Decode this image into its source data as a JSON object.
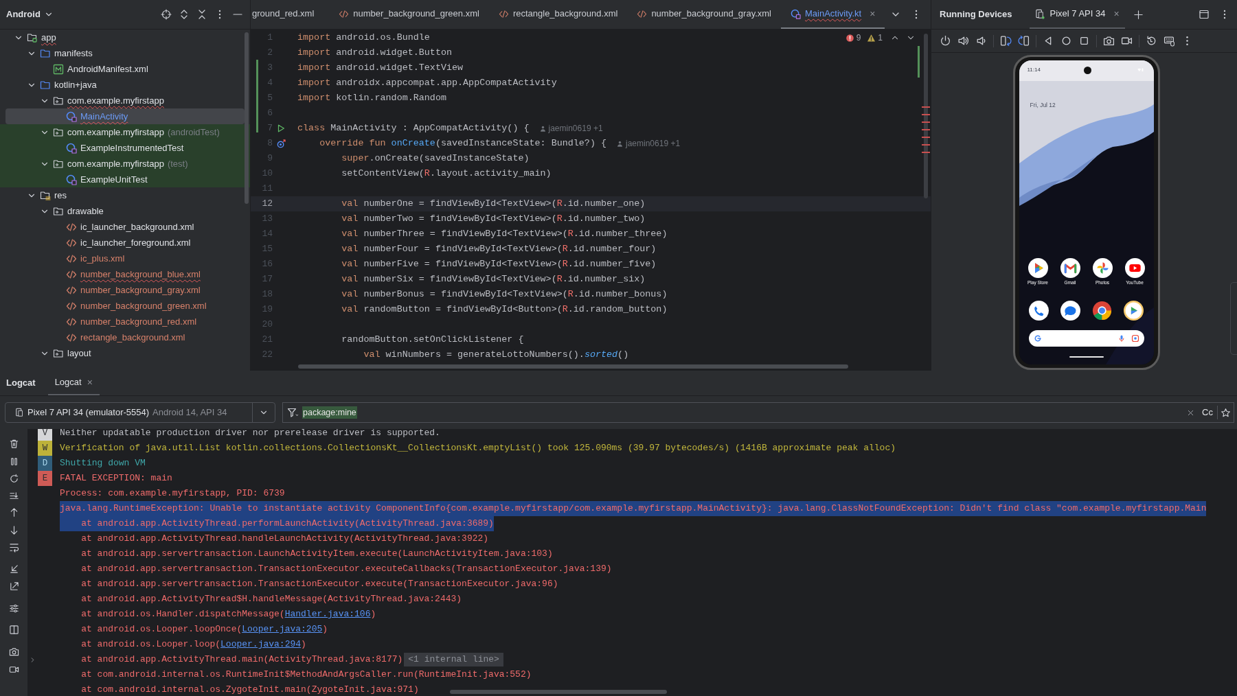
{
  "project_panel": {
    "title": "Android",
    "tree": [
      {
        "label": "app",
        "kind": "module",
        "expanded": true,
        "selected": false,
        "error": true,
        "color": "#dfe1e5",
        "children": [
          {
            "label": "manifests",
            "kind": "folder",
            "expanded": true,
            "selected": false,
            "error": false,
            "color": "#dfe1e5",
            "children": [
              {
                "label": "AndroidManifest.xml",
                "kind": "manifest",
                "selected": false,
                "error": false,
                "color": "#dfe1e5"
              }
            ]
          },
          {
            "label": "kotlin+java",
            "kind": "folder",
            "expanded": true,
            "selected": false,
            "error": false,
            "color": "#dfe1e5",
            "children": [
              {
                "label": "com.example.myfirstapp",
                "kind": "package",
                "expanded": true,
                "selected": false,
                "error": true,
                "test_source": false,
                "color": "#dfe1e5",
                "children": [
                  {
                    "label": "MainActivity",
                    "kind": "class",
                    "selected": true,
                    "error": true,
                    "color": "#6c9bf6"
                  }
                ]
              },
              {
                "label": "com.example.myfirstapp",
                "suffix": "(androidTest)",
                "kind": "package",
                "expanded": true,
                "selected": false,
                "error": false,
                "test_source": true,
                "color": "#dfe1e5",
                "children": [
                  {
                    "label": "ExampleInstrumentedTest",
                    "kind": "class",
                    "selected": false,
                    "error": false,
                    "color": "#dfe1e5"
                  }
                ]
              },
              {
                "label": "com.example.myfirstapp",
                "suffix": "(test)",
                "kind": "package",
                "expanded": true,
                "selected": false,
                "error": false,
                "test_source": true,
                "color": "#dfe1e5",
                "children": [
                  {
                    "label": "ExampleUnitTest",
                    "kind": "class",
                    "selected": false,
                    "error": false,
                    "color": "#dfe1e5"
                  }
                ]
              }
            ]
          },
          {
            "label": "res",
            "kind": "res",
            "expanded": true,
            "selected": false,
            "error": false,
            "color": "#dfe1e5",
            "children": [
              {
                "label": "drawable",
                "kind": "package",
                "expanded": true,
                "selected": false,
                "error": false,
                "color": "#dfe1e5",
                "children": [
                  {
                    "label": "ic_launcher_background.xml",
                    "kind": "xml",
                    "selected": false,
                    "error": false,
                    "color": "#dfe1e5"
                  },
                  {
                    "label": "ic_launcher_foreground.xml",
                    "kind": "xml",
                    "selected": false,
                    "error": false,
                    "color": "#dfe1e5"
                  },
                  {
                    "label": "ic_plus.xml",
                    "kind": "xml",
                    "selected": false,
                    "error": false,
                    "color": "#d9826b"
                  },
                  {
                    "label": "number_background_blue.xml",
                    "kind": "xml",
                    "selected": false,
                    "error": true,
                    "color": "#d9826b"
                  },
                  {
                    "label": "number_background_gray.xml",
                    "kind": "xml",
                    "selected": false,
                    "error": false,
                    "color": "#d9826b"
                  },
                  {
                    "label": "number_background_green.xml",
                    "kind": "xml",
                    "selected": false,
                    "error": false,
                    "color": "#d9826b"
                  },
                  {
                    "label": "number_background_red.xml",
                    "kind": "xml",
                    "selected": false,
                    "error": false,
                    "color": "#d9826b"
                  },
                  {
                    "label": "rectangle_background.xml",
                    "kind": "xml",
                    "selected": false,
                    "error": false,
                    "color": "#d9826b"
                  }
                ]
              },
              {
                "label": "layout",
                "kind": "package",
                "expanded": true,
                "selected": false,
                "error": false,
                "color": "#dfe1e5"
              }
            ]
          }
        ]
      }
    ]
  },
  "editor": {
    "tabs": [
      {
        "label": "ground_red.xml",
        "kind": "cut",
        "selected": false,
        "error": false
      },
      {
        "label": "number_background_green.xml",
        "kind": "xml",
        "selected": false,
        "error": false
      },
      {
        "label": "rectangle_background.xml",
        "kind": "xml",
        "selected": false,
        "error": false
      },
      {
        "label": "number_background_gray.xml",
        "kind": "xml",
        "selected": false,
        "error": false
      },
      {
        "label": "MainActivity.kt",
        "kind": "class",
        "selected": true,
        "error": true,
        "close": "×"
      }
    ],
    "errors": "9",
    "warnings": "1",
    "lines": [
      {
        "number": "1",
        "current": false,
        "tokens": [
          {
            "kind": "keyword",
            "text": "import"
          },
          {
            "kind": "text",
            "text": " android.os.Bundle"
          }
        ]
      },
      {
        "number": "2",
        "current": false,
        "tokens": [
          {
            "kind": "keyword",
            "text": "import"
          },
          {
            "kind": "text",
            "text": " android.widget.Button"
          }
        ]
      },
      {
        "number": "3",
        "current": false,
        "tokens": [
          {
            "kind": "keyword",
            "text": "import"
          },
          {
            "kind": "text",
            "text": " android.widget.TextView"
          }
        ]
      },
      {
        "number": "4",
        "current": false,
        "tokens": [
          {
            "kind": "keyword",
            "text": "import"
          },
          {
            "kind": "text",
            "text": " androidx.appcompat.app.AppCompatActivity"
          }
        ]
      },
      {
        "number": "5",
        "current": false,
        "tokens": [
          {
            "kind": "keyword",
            "text": "import"
          },
          {
            "kind": "text",
            "text": " kotlin.random.Random"
          }
        ]
      },
      {
        "number": "6",
        "current": false
      },
      {
        "number": "7",
        "current": false,
        "kind": "run",
        "author": "jaemin0619 +1",
        "tokens": [
          {
            "kind": "keyword",
            "text": "class"
          },
          {
            "kind": "text",
            "text": " MainActivity : AppCompatActivity() {"
          }
        ]
      },
      {
        "number": "8",
        "current": false,
        "kind": "override",
        "author": "jaemin0619 +1",
        "tokens": [
          {
            "kind": "keyword",
            "text": "    override fun "
          },
          {
            "kind": "call",
            "text": "onCreate"
          },
          {
            "kind": "text",
            "text": "(savedInstanceState: Bundle?) {"
          }
        ]
      },
      {
        "number": "9",
        "current": false,
        "tokens": [
          {
            "kind": "keyword",
            "text": "        super"
          },
          {
            "kind": "text",
            "text": ".onCreate(savedInstanceState)"
          }
        ]
      },
      {
        "number": "10",
        "current": false,
        "tokens": [
          {
            "kind": "text",
            "text": "        setContentView("
          },
          {
            "kind": "rref",
            "text": "R"
          },
          {
            "kind": "text",
            "text": ".layout.activity_main)"
          }
        ]
      },
      {
        "number": "11",
        "current": false
      },
      {
        "number": "12",
        "current": true,
        "tokens": [
          {
            "kind": "keyword",
            "text": "        val"
          },
          {
            "kind": "text",
            "text": " numberOne = findViewById<TextView>("
          },
          {
            "kind": "rref",
            "text": "R"
          },
          {
            "kind": "text",
            "text": ".id.number_one)"
          }
        ]
      },
      {
        "number": "13",
        "current": false,
        "tokens": [
          {
            "kind": "keyword",
            "text": "        val"
          },
          {
            "kind": "text",
            "text": " numberTwo = findViewById<TextView>("
          },
          {
            "kind": "rref",
            "text": "R"
          },
          {
            "kind": "text",
            "text": ".id.number_two)"
          }
        ]
      },
      {
        "number": "14",
        "current": false,
        "tokens": [
          {
            "kind": "keyword",
            "text": "        val"
          },
          {
            "kind": "text",
            "text": " numberThree = findViewById<TextView>("
          },
          {
            "kind": "rref",
            "text": "R"
          },
          {
            "kind": "text",
            "text": ".id.number_three)"
          }
        ]
      },
      {
        "number": "15",
        "current": false,
        "tokens": [
          {
            "kind": "keyword",
            "text": "        val"
          },
          {
            "kind": "text",
            "text": " numberFour = findViewById<TextView>("
          },
          {
            "kind": "rref",
            "text": "R"
          },
          {
            "kind": "text",
            "text": ".id.number_four)"
          }
        ]
      },
      {
        "number": "16",
        "current": false,
        "tokens": [
          {
            "kind": "keyword",
            "text": "        val"
          },
          {
            "kind": "text",
            "text": " numberFive = findViewById<TextView>("
          },
          {
            "kind": "rref",
            "text": "R"
          },
          {
            "kind": "text",
            "text": ".id.number_five)"
          }
        ]
      },
      {
        "number": "17",
        "current": false,
        "tokens": [
          {
            "kind": "keyword",
            "text": "        val"
          },
          {
            "kind": "text",
            "text": " numberSix = findViewById<TextView>("
          },
          {
            "kind": "rref",
            "text": "R"
          },
          {
            "kind": "text",
            "text": ".id.number_six)"
          }
        ]
      },
      {
        "number": "18",
        "current": false,
        "tokens": [
          {
            "kind": "keyword",
            "text": "        val"
          },
          {
            "kind": "text",
            "text": " numberBonus = findViewById<TextView>("
          },
          {
            "kind": "rref",
            "text": "R"
          },
          {
            "kind": "text",
            "text": ".id.number_bonus)"
          }
        ]
      },
      {
        "number": "19",
        "current": false,
        "tokens": [
          {
            "kind": "keyword",
            "text": "        val"
          },
          {
            "kind": "text",
            "text": " randomButton = findViewById<Button>("
          },
          {
            "kind": "rref",
            "text": "R"
          },
          {
            "kind": "text",
            "text": ".id.random_button)"
          }
        ]
      },
      {
        "number": "20",
        "current": false
      },
      {
        "number": "21",
        "current": false,
        "tokens": [
          {
            "kind": "text",
            "text": "        randomButton.setOnClickListener {"
          }
        ]
      },
      {
        "number": "22",
        "current": false,
        "tokens": [
          {
            "kind": "keyword",
            "text": "            val"
          },
          {
            "kind": "text",
            "text": " winNumbers = generateLottoNumbers()."
          },
          {
            "kind": "ext",
            "text": "sorted"
          },
          {
            "kind": "text",
            "text": "()"
          }
        ]
      }
    ]
  },
  "running_devices": {
    "title": "Running Devices",
    "tab": {
      "label": "Pixel 7 API 34",
      "selected": true,
      "close": "×"
    },
    "phone": {
      "time": "11:14",
      "date": "Fri, Jul 12",
      "apps": [
        {
          "label": "Play Store",
          "kind": "play"
        },
        {
          "label": "Gmail",
          "kind": "gmail"
        },
        {
          "label": "Photos",
          "kind": "photos"
        },
        {
          "label": "YouTube",
          "kind": "youtube"
        }
      ],
      "dock": [
        {
          "kind": "phone"
        },
        {
          "kind": "messages"
        },
        {
          "kind": "chrome"
        },
        {
          "kind": "games"
        }
      ]
    }
  },
  "logcat": {
    "title": "Logcat",
    "tab": {
      "label": "Logcat",
      "selected": true,
      "close": "×"
    },
    "device": {
      "name": "Pixel 7 API 34 (emulator-5554)",
      "detail": "Android 14, API 34"
    },
    "filter": "package:mine",
    "case_button": "Cc",
    "rows": [
      {
        "kind": "verbose",
        "badge": "V",
        "text": "Neither updatable production driver nor prerelease driver is supported.",
        "selected": false
      },
      {
        "kind": "warn",
        "badge": "W",
        "text": "Verification of java.util.List kotlin.collections.CollectionsKt__CollectionsKt.emptyList() took 125.090ms (39.97 bytecodes/s) (1416B approximate peak alloc)",
        "selected": false
      },
      {
        "kind": "debug",
        "badge": "D",
        "text": "Shutting down VM",
        "selected": false
      },
      {
        "kind": "error",
        "badge": "E",
        "text": "FATAL EXCEPTION: main",
        "selected": false
      },
      {
        "kind": "error",
        "text": "Process: com.example.myfirstapp, PID: 6739",
        "selected": false
      },
      {
        "kind": "error",
        "text": "java.lang.RuntimeException: Unable to instantiate activity ComponentInfo{com.example.myfirstapp/com.example.myfirstapp.MainActivity}: java.lang.ClassNotFoundException: Didn't find class \"com.example.myfirstapp.Main",
        "selected": true
      },
      {
        "kind": "error",
        "text": "    at android.app.ActivityThread.performLaunchActivity(ActivityThread.java:3689)",
        "selected": true
      },
      {
        "kind": "error",
        "text": "    at android.app.ActivityThread.handleLaunchActivity(ActivityThread.java:3922)",
        "selected": false
      },
      {
        "kind": "error",
        "text": "    at android.app.servertransaction.LaunchActivityItem.execute(LaunchActivityItem.java:103)",
        "selected": false
      },
      {
        "kind": "error",
        "text": "    at android.app.servertransaction.TransactionExecutor.executeCallbacks(TransactionExecutor.java:139)",
        "selected": false
      },
      {
        "kind": "error",
        "text": "    at android.app.servertransaction.TransactionExecutor.execute(TransactionExecutor.java:96)",
        "selected": false
      },
      {
        "kind": "error",
        "text": "    at android.app.ActivityThread$H.handleMessage(ActivityThread.java:2443)",
        "selected": false
      },
      {
        "kind": "error",
        "text": "    at android.os.Handler.dispatchMessage(",
        "link": "Handler.java:106",
        "after": ")",
        "selected": false
      },
      {
        "kind": "error",
        "text": "    at android.os.Looper.loopOnce(",
        "link": "Looper.java:205",
        "after": ")",
        "selected": false
      },
      {
        "kind": "error",
        "text": "    at android.os.Looper.loop(",
        "link": "Looper.java:294",
        "after": ")",
        "selected": false
      },
      {
        "kind": "error",
        "text": "    at android.app.ActivityThread.main(ActivityThread.java:8177)",
        "fold": "<1 internal line>",
        "selected": false
      },
      {
        "kind": "error",
        "text": "    at com.android.internal.os.RuntimeInit$MethodAndArgsCaller.run(RuntimeInit.java:552)",
        "selected": false
      },
      {
        "kind": "error",
        "text": "    at com.android.internal.os.ZygoteInit.main(ZygoteInit.java:971)",
        "selected": false
      }
    ]
  }
}
